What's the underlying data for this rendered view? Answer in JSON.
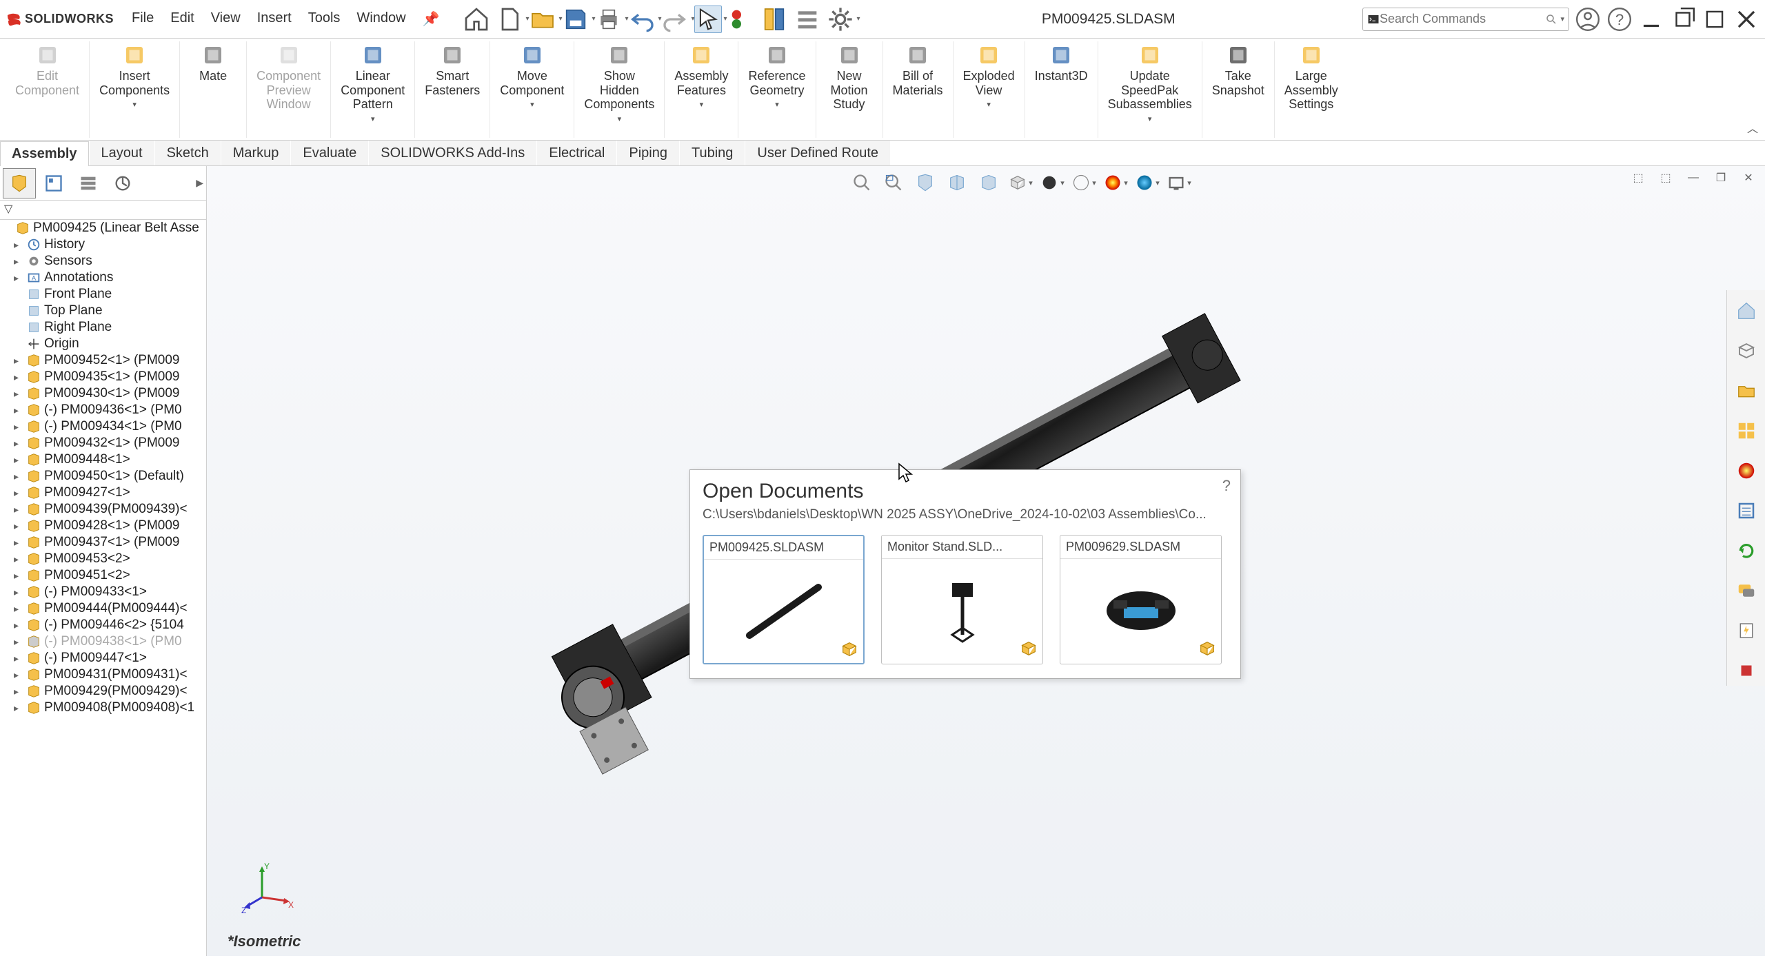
{
  "app": {
    "logo_text": "SOLIDWORKS",
    "document_title": "PM009425.SLDASM",
    "search_placeholder": "Search Commands"
  },
  "menus": [
    "File",
    "Edit",
    "View",
    "Insert",
    "Tools",
    "Window"
  ],
  "ribbon": {
    "buttons": [
      {
        "label": "Edit\nComponent",
        "disabled": true
      },
      {
        "label": "Insert\nComponents",
        "dd": true
      },
      {
        "label": "Mate"
      },
      {
        "label": "Component\nPreview\nWindow",
        "disabled": true
      },
      {
        "label": "Linear\nComponent\nPattern",
        "dd": true
      },
      {
        "label": "Smart\nFasteners"
      },
      {
        "label": "Move\nComponent",
        "dd": true
      },
      {
        "label": "Show\nHidden\nComponents",
        "dd": true
      },
      {
        "label": "Assembly\nFeatures",
        "dd": true
      },
      {
        "label": "Reference\nGeometry",
        "dd": true
      },
      {
        "label": "New\nMotion\nStudy"
      },
      {
        "label": "Bill of\nMaterials"
      },
      {
        "label": "Exploded\nView",
        "dd": true
      },
      {
        "label": "Instant3D"
      },
      {
        "label": "Update\nSpeedPak\nSubassemblies",
        "dd": true
      },
      {
        "label": "Take\nSnapshot"
      },
      {
        "label": "Large\nAssembly\nSettings"
      }
    ]
  },
  "tabs": [
    "Assembly",
    "Layout",
    "Sketch",
    "Markup",
    "Evaluate",
    "SOLIDWORKS Add-Ins",
    "Electrical",
    "Piping",
    "Tubing",
    "User Defined Route"
  ],
  "active_tab": 0,
  "tree": {
    "root": "PM009425 (Linear Belt Asse",
    "top_items": [
      "History",
      "Sensors",
      "Annotations",
      "Front Plane",
      "Top Plane",
      "Right Plane",
      "Origin"
    ],
    "components": [
      "PM009452<1> (PM009",
      "PM009435<1> (PM009",
      "PM009430<1> (PM009",
      "(-) PM009436<1> (PM0",
      "(-) PM009434<1> (PM0",
      "PM009432<1> (PM009",
      "PM009448<1>",
      "PM009450<1> (Default)",
      "PM009427<1>",
      "PM009439(PM009439)<",
      "PM009428<1> (PM009",
      "PM009437<1> (PM009",
      "PM009453<2>",
      "PM009451<2>",
      "(-) PM009433<1>",
      "PM009444(PM009444)<",
      "(-) PM009446<2> {5104",
      "(-) PM009438<1> (PM0",
      "(-) PM009447<1>",
      "PM009431(PM009431)<",
      "PM009429(PM009429)<",
      "PM009408(PM009408)<1"
    ],
    "inactive_index": 17
  },
  "view_label": "*Isometric",
  "open_documents": {
    "title": "Open Documents",
    "path": "C:\\Users\\bdaniels\\Desktop\\WN 2025 ASSY\\OneDrive_2024-10-02\\03 Assemblies\\Co...",
    "items": [
      {
        "name": "PM009425.SLDASM",
        "selected": true
      },
      {
        "name": "Monitor Stand.SLD..."
      },
      {
        "name": "PM009629.SLDASM"
      }
    ]
  },
  "colors": {
    "accent": "#d8e6f2",
    "border": "#d0d0d0"
  }
}
